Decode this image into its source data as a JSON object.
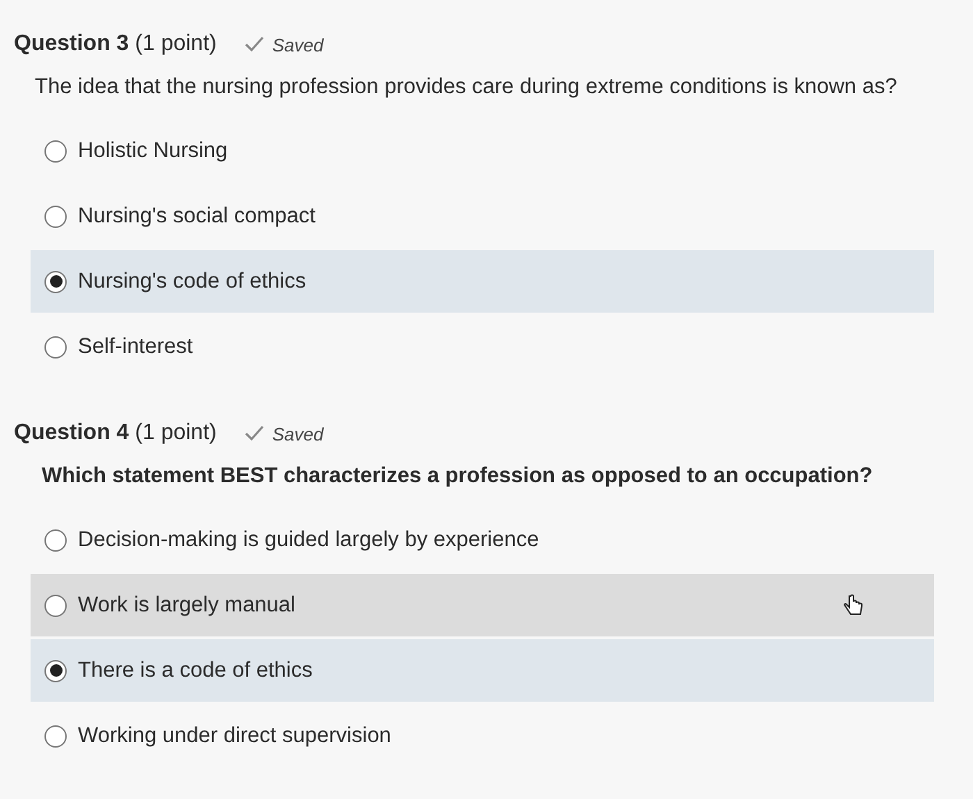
{
  "questions": [
    {
      "number": "Question 3",
      "points": "(1 point)",
      "status": "Saved",
      "text": "The idea that the nursing profession provides care during extreme conditions is known as?",
      "bold": false,
      "options": [
        {
          "label": "Holistic Nursing",
          "selected": false,
          "hovered": false
        },
        {
          "label": "Nursing's social compact",
          "selected": false,
          "hovered": false
        },
        {
          "label": "Nursing's code of ethics",
          "selected": true,
          "hovered": false
        },
        {
          "label": "Self-interest",
          "selected": false,
          "hovered": false
        }
      ]
    },
    {
      "number": "Question 4",
      "points": "(1 point)",
      "status": "Saved",
      "text": "Which statement BEST characterizes a profession as opposed to an occupation?",
      "bold": true,
      "options": [
        {
          "label": "Decision-making is guided largely by experience",
          "selected": false,
          "hovered": false
        },
        {
          "label": "Work is largely manual",
          "selected": false,
          "hovered": true
        },
        {
          "label": "There is a code of ethics",
          "selected": true,
          "hovered": false
        },
        {
          "label": "Working under direct supervision",
          "selected": false,
          "hovered": false
        }
      ]
    }
  ]
}
